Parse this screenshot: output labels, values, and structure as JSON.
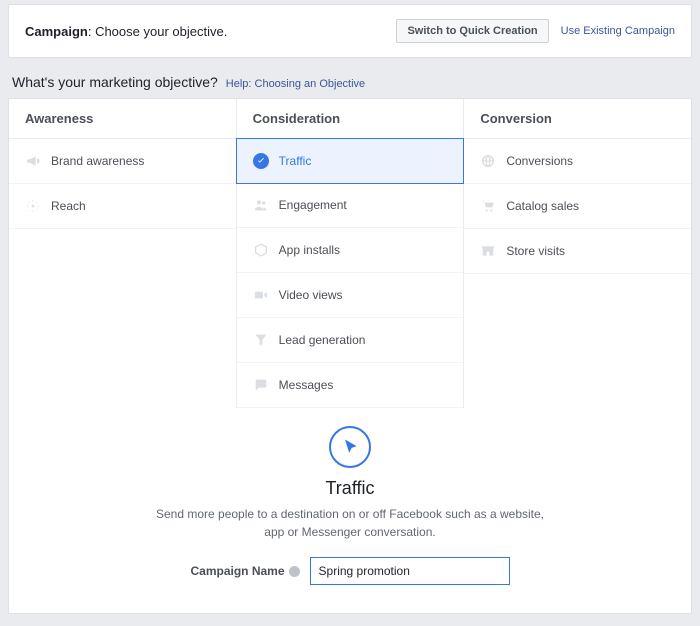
{
  "header": {
    "campaign_label": "Campaign",
    "campaign_sub": ": Choose your objective.",
    "quick_button": "Switch to Quick Creation",
    "existing_link": "Use Existing Campaign"
  },
  "question": {
    "text": "What's your marketing objective?",
    "help": "Help: Choosing an Objective"
  },
  "columns": {
    "awareness": {
      "header": "Awareness",
      "items": [
        {
          "label": "Brand awareness"
        },
        {
          "label": "Reach"
        }
      ]
    },
    "consideration": {
      "header": "Consideration",
      "items": [
        {
          "label": "Traffic",
          "selected": true
        },
        {
          "label": "Engagement"
        },
        {
          "label": "App installs"
        },
        {
          "label": "Video views"
        },
        {
          "label": "Lead generation"
        },
        {
          "label": "Messages"
        }
      ]
    },
    "conversion": {
      "header": "Conversion",
      "items": [
        {
          "label": "Conversions"
        },
        {
          "label": "Catalog sales"
        },
        {
          "label": "Store visits"
        }
      ]
    }
  },
  "detail": {
    "title": "Traffic",
    "description": "Send more people to a destination on or off Facebook such as a website, app or Messenger conversation.",
    "field_label": "Campaign Name",
    "input_value": "Spring promotion"
  }
}
